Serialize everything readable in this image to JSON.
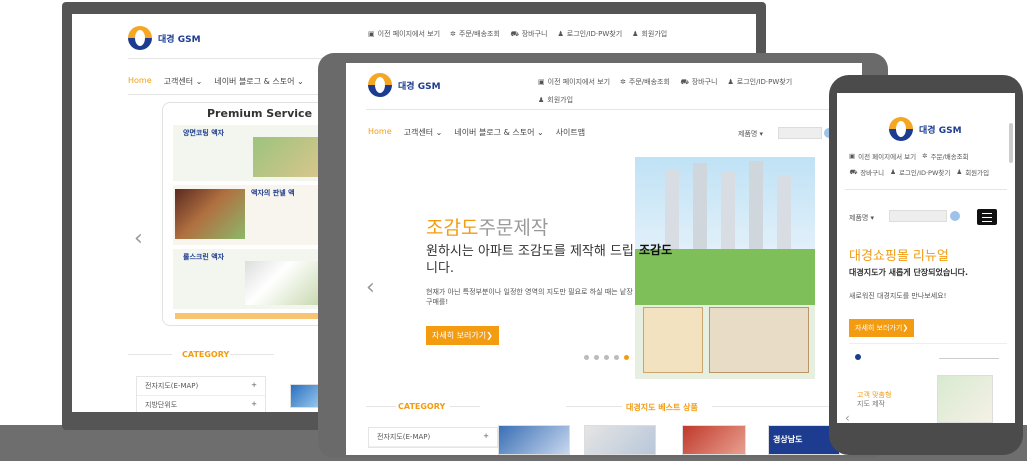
{
  "brand": {
    "logo_text": "대경 GSM",
    "accent": "#f39c12",
    "navy": "#1d3c8f"
  },
  "top_links": {
    "recent": "이전 페이지에서 보기",
    "order": "주문/배송조회",
    "cart": "장바구니",
    "login": "로그인/ID·PW찾기",
    "join": "회원가입"
  },
  "nav": {
    "home": "Home",
    "support": "고객센터",
    "blog": "네이버 블로그 & 스토어",
    "sitemap": "사이트맵"
  },
  "laptop": {
    "premium_title": "Premium Service",
    "cards": [
      {
        "title": "양면코팅 액자"
      },
      {
        "title": "액자의 판넬 액"
      },
      {
        "title": "롤스크린 액자"
      }
    ],
    "category_title": "CATEGORY",
    "categories": [
      "전자지도(E-MAP)",
      "지방단위도"
    ]
  },
  "tablet": {
    "search_label": "제품명",
    "hero_title_1": "조감도",
    "hero_title_2": "주문제작",
    "hero_sub": "원하시는 아파트 조감도를 제작해 드립니다.",
    "hero_desc": "현재가 아닌 특정부분이나 일정한 영역의 지도만 필요로 하실 때는 낱장구매를!",
    "cta": "자세히 보러가기",
    "category_title": "CATEGORY",
    "best_title": "대경지도 베스트 상품",
    "categories": [
      "전자지도(E-MAP)"
    ],
    "product_sign": "경상남도"
  },
  "phone": {
    "search_label": "제품명",
    "headline": "대경쇼핑몰 리뉴얼",
    "sub": "대경지도가 새롭게 단장되었습니다.",
    "desc": "새로워진 대경지도를 만나보세요!",
    "cta": "자세히 보러가기",
    "mini_title_1": "고객 맞춤형",
    "mini_title_2": "지도 제작"
  }
}
